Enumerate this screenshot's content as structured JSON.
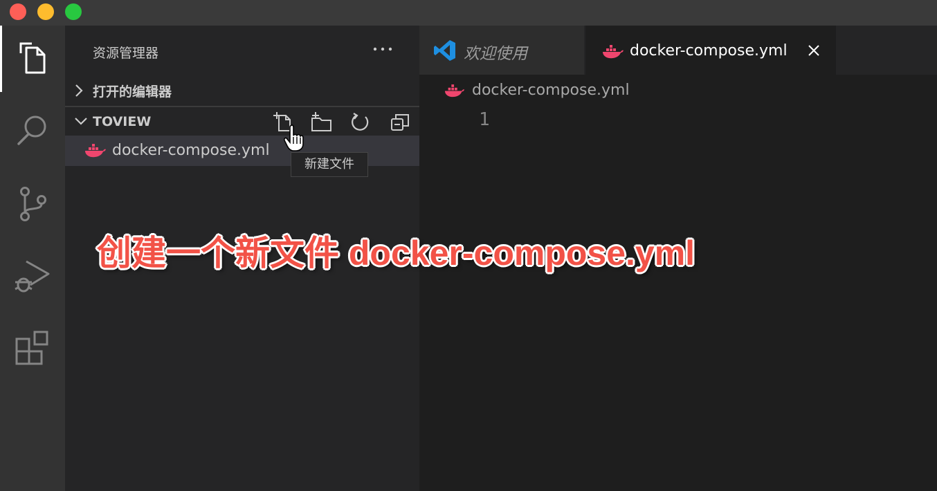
{
  "window": {
    "traffic_lights": [
      "close",
      "minimize",
      "maximize"
    ]
  },
  "activity_bar": {
    "items": [
      {
        "icon": "files-icon",
        "active": true
      },
      {
        "icon": "search-icon"
      },
      {
        "icon": "source-control-icon"
      },
      {
        "icon": "run-debug-icon"
      },
      {
        "icon": "extensions-icon"
      }
    ]
  },
  "sidebar": {
    "title": "资源管理器",
    "more_icon": "ellipsis-icon",
    "open_editors_label": "打开的编辑器",
    "folder_label": "TOVIEW",
    "toolbar": [
      "new-file-icon",
      "new-folder-icon",
      "refresh-icon",
      "collapse-all-icon"
    ],
    "files": [
      {
        "name": "docker-compose.yml",
        "icon": "docker-icon"
      }
    ],
    "tooltip": "新建文件"
  },
  "editor": {
    "tabs": [
      {
        "label": "欢迎使用",
        "icon": "vscode-icon",
        "active": false
      },
      {
        "label": "docker-compose.yml",
        "icon": "docker-icon",
        "active": true
      }
    ],
    "breadcrumb": "docker-compose.yml",
    "line_number": "1"
  },
  "annotation": "创建一个新文件 docker-compose.yml",
  "colors": {
    "docker": "#f0466e",
    "annotation": "#f25247",
    "vscode_blue": "#1e8fe1"
  }
}
